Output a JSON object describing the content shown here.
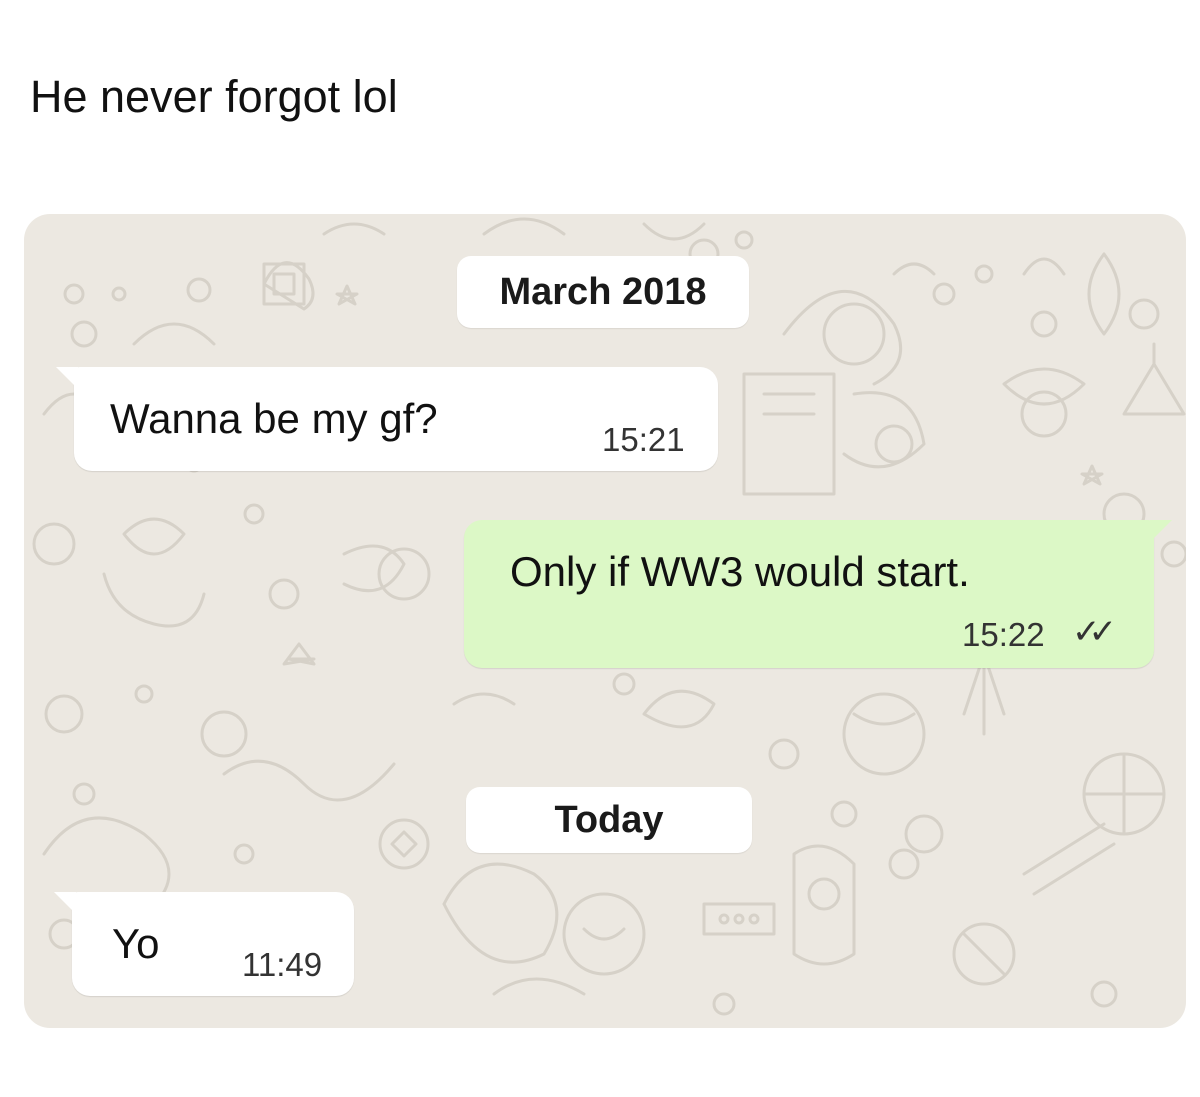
{
  "caption": "He never forgot lol",
  "chat": {
    "date_chips": [
      "March 2018",
      "Today"
    ],
    "messages": [
      {
        "direction": "incoming",
        "text": "Wanna be my gf?",
        "time": "15:21"
      },
      {
        "direction": "outgoing",
        "text": "Only if WW3 would start.",
        "time": "15:22",
        "status_icon": "double-check-icon"
      },
      {
        "direction": "incoming",
        "text": "Yo",
        "time": "11:49"
      }
    ]
  },
  "colors": {
    "chat_background": "#ece8e1",
    "incoming_bubble": "#ffffff",
    "outgoing_bubble": "#dcf8c6"
  }
}
